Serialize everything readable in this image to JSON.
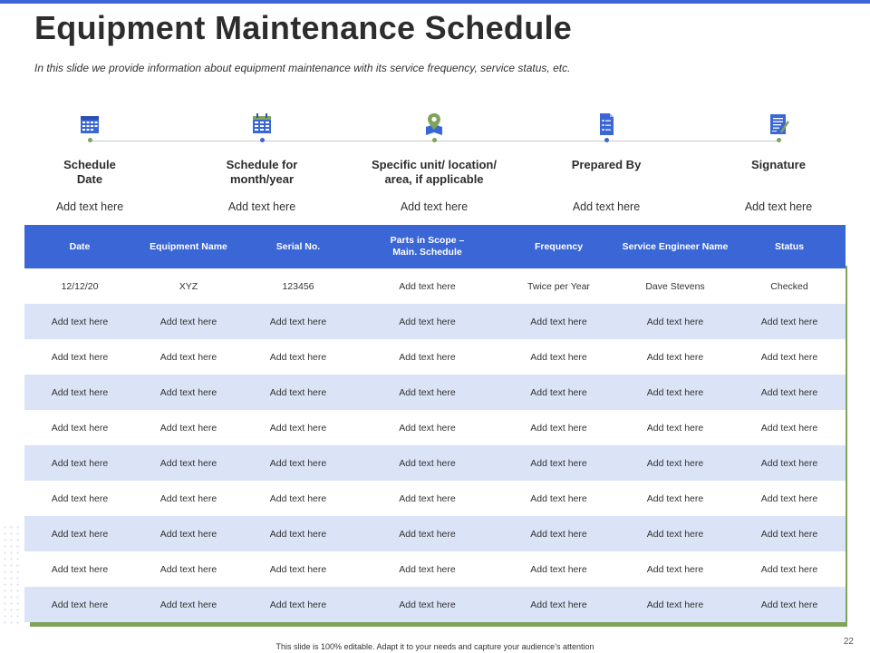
{
  "page": {
    "title": "Equipment Maintenance Schedule",
    "subtitle": "In this slide we provide information about equipment maintenance with its service frequency, service status, etc.",
    "footer": "This slide is 100% editable. Adapt it to your needs and capture your audience’s attention",
    "page_number": "22"
  },
  "colors": {
    "accent": "#3a66d6",
    "green": "#7fa35a",
    "row_alt": "#dbe3f7"
  },
  "timeline": [
    {
      "icon": "calendar-icon",
      "label1": "Schedule",
      "label2": "Date",
      "value": "Add text here"
    },
    {
      "icon": "calendar-grid-icon",
      "label1": "Schedule for",
      "label2": "month/year",
      "value": "Add text here"
    },
    {
      "icon": "location-pin-icon",
      "label1": "Specific unit/ location/",
      "label2": "area, if applicable",
      "value": "Add text here"
    },
    {
      "icon": "checklist-document-icon",
      "label1": "Prepared By",
      "label2": "",
      "value": "Add text here"
    },
    {
      "icon": "signature-document-icon",
      "label1": "Signature",
      "label2": "",
      "value": "Add text here"
    }
  ],
  "table": {
    "headers": [
      {
        "line1": "Date",
        "line2": ""
      },
      {
        "line1": "Equipment Name",
        "line2": ""
      },
      {
        "line1": "Serial No.",
        "line2": ""
      },
      {
        "line1": "Parts in Scope –",
        "line2": "Main. Schedule"
      },
      {
        "line1": "Frequency",
        "line2": ""
      },
      {
        "line1": "Service Engineer Name",
        "line2": ""
      },
      {
        "line1": "Status",
        "line2": ""
      }
    ],
    "rows": [
      [
        "12/12/20",
        "XYZ",
        "123456",
        "Add text here",
        "Twice per Year",
        "Dave Stevens",
        "Checked"
      ],
      [
        "Add text here",
        "Add text here",
        "Add text here",
        "Add text here",
        "Add text here",
        "Add text here",
        "Add text here"
      ],
      [
        "Add text here",
        "Add text here",
        "Add text here",
        "Add text here",
        "Add text here",
        "Add text here",
        "Add text here"
      ],
      [
        "Add text here",
        "Add text here",
        "Add text here",
        "Add text here",
        "Add text here",
        "Add text here",
        "Add text here"
      ],
      [
        "Add text here",
        "Add text here",
        "Add text here",
        "Add text here",
        "Add text here",
        "Add text here",
        "Add text here"
      ],
      [
        "Add text here",
        "Add text here",
        "Add text here",
        "Add text here",
        "Add text here",
        "Add text here",
        "Add text here"
      ],
      [
        "Add text here",
        "Add text here",
        "Add text here",
        "Add text here",
        "Add text here",
        "Add text here",
        "Add text here"
      ],
      [
        "Add text here",
        "Add text here",
        "Add text here",
        "Add text here",
        "Add text here",
        "Add text here",
        "Add text here"
      ],
      [
        "Add text here",
        "Add text here",
        "Add text here",
        "Add text here",
        "Add text here",
        "Add text here",
        "Add text here"
      ],
      [
        "Add text here",
        "Add text here",
        "Add text here",
        "Add text here",
        "Add text here",
        "Add text here",
        "Add text here"
      ]
    ]
  }
}
